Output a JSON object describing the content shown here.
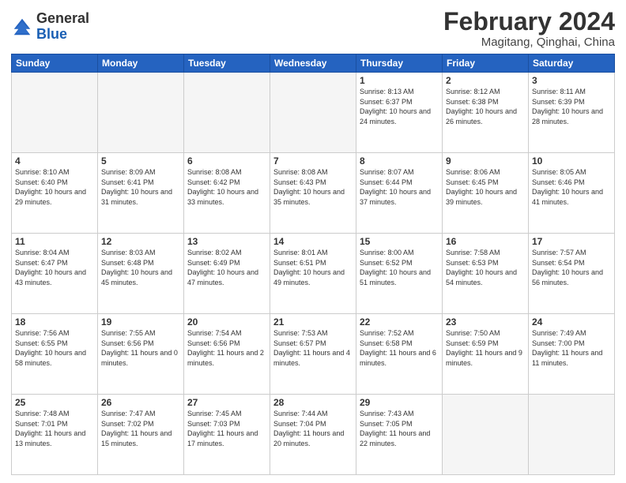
{
  "header": {
    "logo": {
      "general": "General",
      "blue": "Blue"
    },
    "title": "February 2024",
    "subtitle": "Magitang, Qinghai, China"
  },
  "weekdays": [
    "Sunday",
    "Monday",
    "Tuesday",
    "Wednesday",
    "Thursday",
    "Friday",
    "Saturday"
  ],
  "weeks": [
    [
      {
        "day": "",
        "info": ""
      },
      {
        "day": "",
        "info": ""
      },
      {
        "day": "",
        "info": ""
      },
      {
        "day": "",
        "info": ""
      },
      {
        "day": "1",
        "info": "Sunrise: 8:13 AM\nSunset: 6:37 PM\nDaylight: 10 hours\nand 24 minutes."
      },
      {
        "day": "2",
        "info": "Sunrise: 8:12 AM\nSunset: 6:38 PM\nDaylight: 10 hours\nand 26 minutes."
      },
      {
        "day": "3",
        "info": "Sunrise: 8:11 AM\nSunset: 6:39 PM\nDaylight: 10 hours\nand 28 minutes."
      }
    ],
    [
      {
        "day": "4",
        "info": "Sunrise: 8:10 AM\nSunset: 6:40 PM\nDaylight: 10 hours\nand 29 minutes."
      },
      {
        "day": "5",
        "info": "Sunrise: 8:09 AM\nSunset: 6:41 PM\nDaylight: 10 hours\nand 31 minutes."
      },
      {
        "day": "6",
        "info": "Sunrise: 8:08 AM\nSunset: 6:42 PM\nDaylight: 10 hours\nand 33 minutes."
      },
      {
        "day": "7",
        "info": "Sunrise: 8:08 AM\nSunset: 6:43 PM\nDaylight: 10 hours\nand 35 minutes."
      },
      {
        "day": "8",
        "info": "Sunrise: 8:07 AM\nSunset: 6:44 PM\nDaylight: 10 hours\nand 37 minutes."
      },
      {
        "day": "9",
        "info": "Sunrise: 8:06 AM\nSunset: 6:45 PM\nDaylight: 10 hours\nand 39 minutes."
      },
      {
        "day": "10",
        "info": "Sunrise: 8:05 AM\nSunset: 6:46 PM\nDaylight: 10 hours\nand 41 minutes."
      }
    ],
    [
      {
        "day": "11",
        "info": "Sunrise: 8:04 AM\nSunset: 6:47 PM\nDaylight: 10 hours\nand 43 minutes."
      },
      {
        "day": "12",
        "info": "Sunrise: 8:03 AM\nSunset: 6:48 PM\nDaylight: 10 hours\nand 45 minutes."
      },
      {
        "day": "13",
        "info": "Sunrise: 8:02 AM\nSunset: 6:49 PM\nDaylight: 10 hours\nand 47 minutes."
      },
      {
        "day": "14",
        "info": "Sunrise: 8:01 AM\nSunset: 6:51 PM\nDaylight: 10 hours\nand 49 minutes."
      },
      {
        "day": "15",
        "info": "Sunrise: 8:00 AM\nSunset: 6:52 PM\nDaylight: 10 hours\nand 51 minutes."
      },
      {
        "day": "16",
        "info": "Sunrise: 7:58 AM\nSunset: 6:53 PM\nDaylight: 10 hours\nand 54 minutes."
      },
      {
        "day": "17",
        "info": "Sunrise: 7:57 AM\nSunset: 6:54 PM\nDaylight: 10 hours\nand 56 minutes."
      }
    ],
    [
      {
        "day": "18",
        "info": "Sunrise: 7:56 AM\nSunset: 6:55 PM\nDaylight: 10 hours\nand 58 minutes."
      },
      {
        "day": "19",
        "info": "Sunrise: 7:55 AM\nSunset: 6:56 PM\nDaylight: 11 hours\nand 0 minutes."
      },
      {
        "day": "20",
        "info": "Sunrise: 7:54 AM\nSunset: 6:56 PM\nDaylight: 11 hours\nand 2 minutes."
      },
      {
        "day": "21",
        "info": "Sunrise: 7:53 AM\nSunset: 6:57 PM\nDaylight: 11 hours\nand 4 minutes."
      },
      {
        "day": "22",
        "info": "Sunrise: 7:52 AM\nSunset: 6:58 PM\nDaylight: 11 hours\nand 6 minutes."
      },
      {
        "day": "23",
        "info": "Sunrise: 7:50 AM\nSunset: 6:59 PM\nDaylight: 11 hours\nand 9 minutes."
      },
      {
        "day": "24",
        "info": "Sunrise: 7:49 AM\nSunset: 7:00 PM\nDaylight: 11 hours\nand 11 minutes."
      }
    ],
    [
      {
        "day": "25",
        "info": "Sunrise: 7:48 AM\nSunset: 7:01 PM\nDaylight: 11 hours\nand 13 minutes."
      },
      {
        "day": "26",
        "info": "Sunrise: 7:47 AM\nSunset: 7:02 PM\nDaylight: 11 hours\nand 15 minutes."
      },
      {
        "day": "27",
        "info": "Sunrise: 7:45 AM\nSunset: 7:03 PM\nDaylight: 11 hours\nand 17 minutes."
      },
      {
        "day": "28",
        "info": "Sunrise: 7:44 AM\nSunset: 7:04 PM\nDaylight: 11 hours\nand 20 minutes."
      },
      {
        "day": "29",
        "info": "Sunrise: 7:43 AM\nSunset: 7:05 PM\nDaylight: 11 hours\nand 22 minutes."
      },
      {
        "day": "",
        "info": ""
      },
      {
        "day": "",
        "info": ""
      }
    ]
  ]
}
